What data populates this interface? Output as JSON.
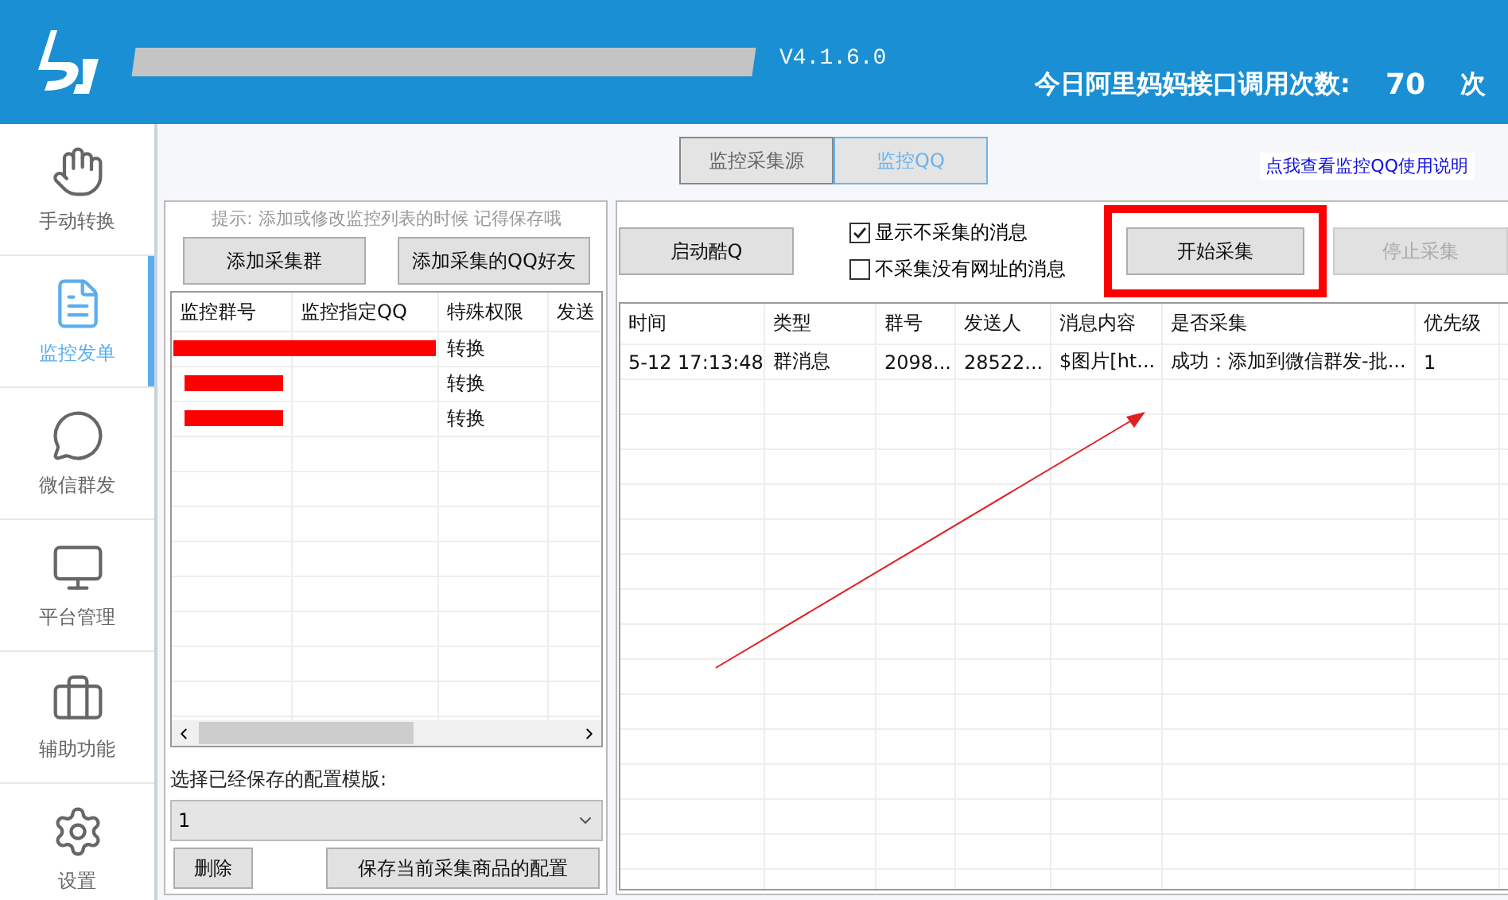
{
  "header": {
    "version": "V4.1.6.0",
    "api_label": "今日阿里妈妈接口调用次数:",
    "api_count": "70",
    "api_unit": "次"
  },
  "sidebar": {
    "items": [
      {
        "label": "手动转换",
        "selected": false
      },
      {
        "label": "监控发单",
        "selected": true
      },
      {
        "label": "微信群发",
        "selected": false
      },
      {
        "label": "平台管理",
        "selected": false
      },
      {
        "label": "辅助功能",
        "selected": false
      },
      {
        "label": "设置",
        "selected": false
      }
    ]
  },
  "tabs": [
    {
      "label": "监控采集源",
      "selected": false
    },
    {
      "label": "监控QQ",
      "selected": true
    }
  ],
  "help_link": "点我查看监控QQ使用说明",
  "left_panel": {
    "hint": "提示: 添加或修改监控列表的时候 记得保存哦",
    "buttons": [
      "添加采集群",
      "添加采集的QQ好友"
    ],
    "table": {
      "columns": [
        "监控群号",
        "监控指定QQ",
        "特殊权限",
        "发送"
      ],
      "rows": [
        {
          "kind": "wide",
          "permission": "转换"
        },
        {
          "kind": "narrow",
          "permission": "转换"
        },
        {
          "kind": "narrow",
          "permission": "转换"
        }
      ]
    },
    "template_label": "选择已经保存的配置模版:",
    "template_value": "1",
    "delete_button": "删除",
    "save_button": "保存当前采集商品的配置"
  },
  "right_panel": {
    "launch_button": "启动酷Q",
    "options": [
      {
        "label": "显示不采集的消息",
        "checked": true
      },
      {
        "label": "不采集没有网址的消息",
        "checked": false
      }
    ],
    "start_button": {
      "label": "开始采集",
      "disabled": false,
      "highlighted": true
    },
    "stop_button": {
      "label": "停止采集",
      "disabled": true,
      "highlighted": false
    },
    "table": {
      "columns": [
        "时间",
        "类型",
        "群号",
        "发送人",
        "消息内容",
        "是否采集",
        "优先级"
      ],
      "rows": [
        [
          "5-12 17:13:48",
          "群消息",
          "2098...",
          "28522...",
          "$图片[ht...",
          "成功：添加到微信群发-批...",
          "1"
        ]
      ]
    }
  }
}
